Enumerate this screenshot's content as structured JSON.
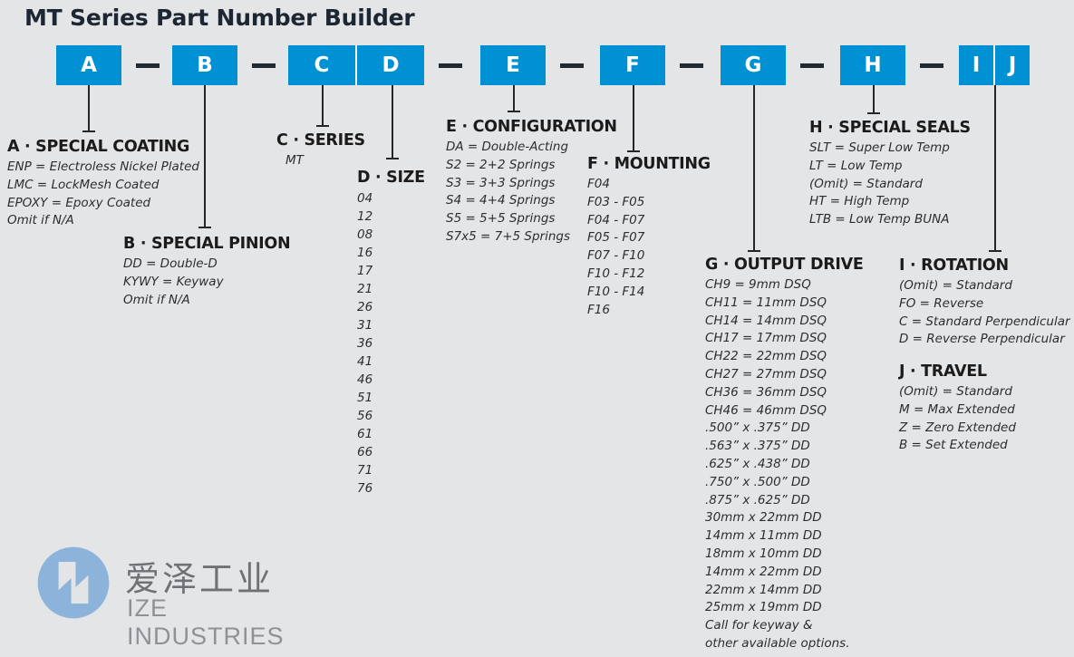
{
  "page": {
    "title": "MT Series Part Number Builder",
    "accent_color": "#0090d4",
    "background_color": "#e4e5e6",
    "dash_color": "#1f2a33"
  },
  "code_boxes": [
    {
      "id": "A",
      "labels": [
        "A"
      ]
    },
    {
      "id": "B",
      "labels": [
        "B"
      ]
    },
    {
      "id": "CD",
      "labels": [
        "C",
        "D"
      ]
    },
    {
      "id": "E",
      "labels": [
        "E"
      ]
    },
    {
      "id": "F",
      "labels": [
        "F"
      ]
    },
    {
      "id": "G",
      "labels": [
        "G"
      ]
    },
    {
      "id": "H",
      "labels": [
        "H"
      ]
    },
    {
      "id": "IJ",
      "labels": [
        "I",
        "J"
      ]
    }
  ],
  "separators": [
    "—",
    "—",
    "—",
    "—",
    "—",
    "—",
    "—"
  ],
  "sections": {
    "a": {
      "heading": "A · SPECIAL COATING",
      "items": [
        "ENP = Electroless Nickel Plated",
        "LMC = LockMesh Coated",
        "EPOXY = Epoxy Coated",
        "Omit if N/A"
      ]
    },
    "b": {
      "heading": "B · SPECIAL PINION",
      "items": [
        "DD = Double-D",
        "KYWY = Keyway",
        "Omit if N/A"
      ]
    },
    "c": {
      "heading": "C · SERIES",
      "items": [
        "MT"
      ]
    },
    "d": {
      "heading": "D · SIZE",
      "items": [
        "04",
        "12",
        "08",
        "16",
        "17",
        "21",
        "26",
        "31",
        "36",
        "41",
        "46",
        "51",
        "56",
        "61",
        "66",
        "71",
        "76"
      ]
    },
    "e": {
      "heading": "E · CONFIGURATION",
      "items": [
        "DA = Double-Acting",
        "S2 = 2+2 Springs",
        "S3 = 3+3 Springs",
        "S4 = 4+4 Springs",
        "S5 = 5+5 Springs",
        "S7x5 = 7+5 Springs"
      ]
    },
    "f": {
      "heading": "F · MOUNTING",
      "items": [
        "F04",
        "F03 - F05",
        "F04 - F07",
        "F05 - F07",
        "F07 - F10",
        "F10 - F12",
        "F10 - F14",
        "F16"
      ]
    },
    "g": {
      "heading": "G · OUTPUT DRIVE",
      "items": [
        "CH9 = 9mm DSQ",
        "CH11 = 11mm DSQ",
        "CH14 = 14mm DSQ",
        "CH17 = 17mm DSQ",
        "CH22 = 22mm DSQ",
        "CH27 = 27mm DSQ",
        "CH36 = 36mm DSQ",
        "CH46 = 46mm DSQ",
        ".500” x .375” DD",
        ".563” x .375” DD",
        ".625” x .438” DD",
        ".750” x .500” DD",
        ".875” x .625” DD",
        "30mm x 22mm DD",
        "14mm x 11mm DD",
        "18mm x 10mm DD",
        "14mm x 22mm DD",
        "22mm x 14mm DD",
        "25mm x 19mm DD",
        "Call for keyway &",
        "other available options."
      ]
    },
    "h": {
      "heading": "H · SPECIAL SEALS",
      "items": [
        "SLT = Super Low Temp",
        "LT = Low Temp",
        "(Omit) = Standard",
        "HT = High Temp",
        "LTB = Low Temp BUNA"
      ]
    },
    "i": {
      "heading": "I · ROTATION",
      "items": [
        "(Omit) = Standard",
        "FO = Reverse",
        "C = Standard Perpendicular",
        "D = Reverse Perpendicular"
      ]
    },
    "j": {
      "heading": "J · TRAVEL",
      "items": [
        "(Omit) = Standard",
        "M = Max Extended",
        "Z = Zero Extended",
        "B = Set Extended"
      ]
    }
  },
  "logo": {
    "chinese_name": "爱泽工业",
    "english_name": "IZE INDUSTRIES",
    "mark_color": "#8cb3d9",
    "text_color": "#6e7276"
  }
}
